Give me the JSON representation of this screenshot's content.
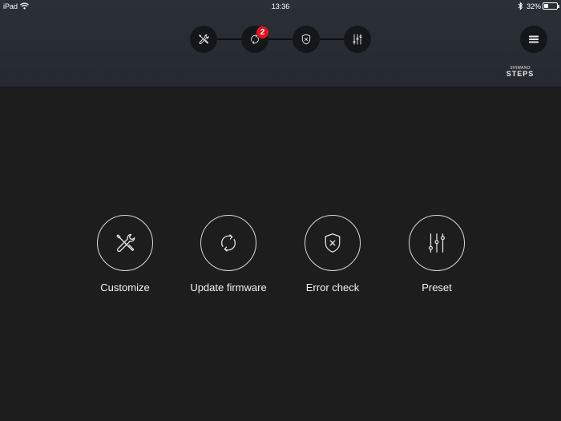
{
  "status_bar": {
    "device": "iPad",
    "time": "13:36",
    "battery_percent": "32%",
    "battery_level": 0.32,
    "icons": [
      "wifi-icon",
      "bluetooth-icon",
      "battery-icon"
    ]
  },
  "step_nav": {
    "steps": [
      {
        "id": "customize",
        "icon": "wrench-screwdriver-icon"
      },
      {
        "id": "update",
        "icon": "refresh-icon",
        "badge": "2"
      },
      {
        "id": "error_check",
        "icon": "shield-x-icon"
      },
      {
        "id": "preset",
        "icon": "sliders-icon"
      }
    ],
    "menu_icon": "hamburger-icon"
  },
  "logo": {
    "top": "SHIMANO",
    "bottom": "STEPS"
  },
  "tiles": [
    {
      "label": "Customize",
      "icon": "wrench-screwdriver-icon"
    },
    {
      "label": "Update firmware",
      "icon": "refresh-icon"
    },
    {
      "label": "Error check",
      "icon": "shield-x-icon"
    },
    {
      "label": "Preset",
      "icon": "sliders-icon"
    }
  ],
  "colors": {
    "header_bg": "#2a2f36",
    "body_bg": "#1d1d1e",
    "badge": "#e5131d",
    "icon_stroke": "#e6e6e6"
  }
}
